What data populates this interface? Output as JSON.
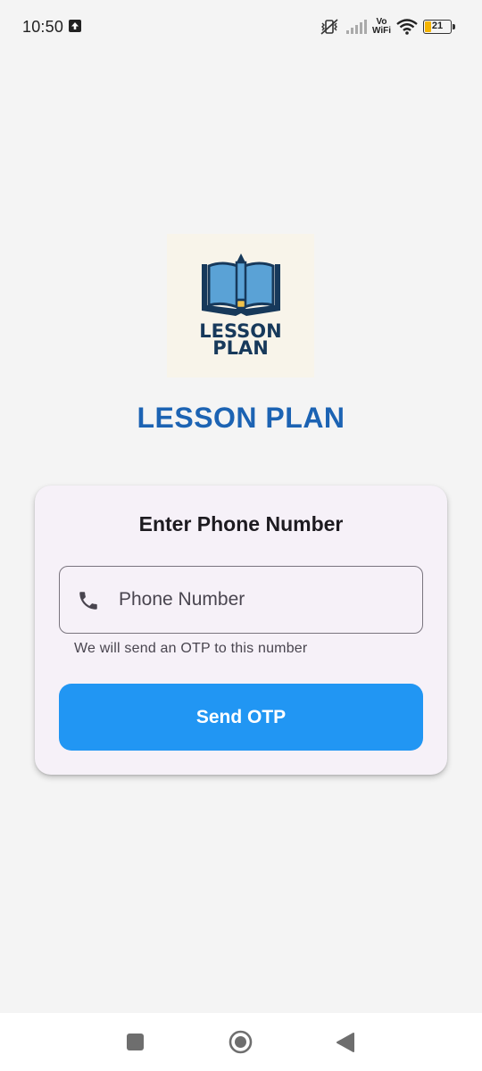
{
  "status_bar": {
    "time": "10:50",
    "vowifi_top": "Vo",
    "vowifi_bottom": "WiFi",
    "battery_level": "21",
    "icons": [
      "upload-icon",
      "vibrate-icon",
      "signal-icon",
      "wifi-icon",
      "battery-icon"
    ]
  },
  "logo": {
    "line1": "LESSON",
    "line2": "PLAN",
    "colors": {
      "background": "#f8f4ea",
      "book_dark": "#17395b",
      "book_light": "#5aa2d6",
      "pencil_tip": "#f0c24b"
    }
  },
  "app_title": "LESSON PLAN",
  "login_card": {
    "title": "Enter Phone Number",
    "phone_input": {
      "placeholder": "Phone Number",
      "value": ""
    },
    "helper_text": "We will send an OTP to this number",
    "send_button_label": "Send OTP"
  },
  "navigation_bar": {
    "buttons": [
      "recent-apps-icon",
      "home-icon",
      "back-icon"
    ]
  },
  "colors": {
    "accent": "#2196f3",
    "title_blue": "#1c63b3",
    "background": "#f4f4f4",
    "card_background": "#f6f1f8"
  }
}
